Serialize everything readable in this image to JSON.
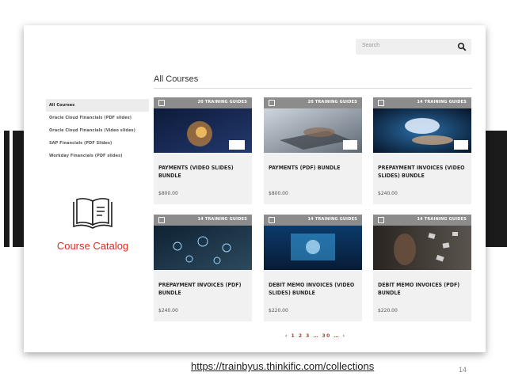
{
  "search": {
    "placeholder": "Search"
  },
  "page_title": "All Courses",
  "sidebar": {
    "items": [
      {
        "label": "All Courses"
      },
      {
        "label": "Oracle Cloud Financials (PDF slides)"
      },
      {
        "label": "Oracle Cloud Financials (Video slides)"
      },
      {
        "label": "SAP Financials (PDF Slides)"
      },
      {
        "label": "Workday Financials (PDF slides)"
      }
    ]
  },
  "catalog": {
    "label": "Course Catalog",
    "icon": "open-book-icon"
  },
  "courses": [
    {
      "count": "20 TRAINING GUIDES",
      "name": "PAYMENTS (VIDEO SLIDES) BUNDLE",
      "price": "$800.00"
    },
    {
      "count": "20 TRAINING GUIDES",
      "name": "PAYMENTS (PDF) BUNDLE",
      "price": "$800.00"
    },
    {
      "count": "14 TRAINING GUIDES",
      "name": "PREPAYMENT INVOICES (VIDEO SLIDES) BUNDLE",
      "price": "$240.00"
    },
    {
      "count": "14 TRAINING GUIDES",
      "name": "PREPAYMENT INVOICES (PDF) BUNDLE",
      "price": "$240.00"
    },
    {
      "count": "14 TRAINING GUIDES",
      "name": "DEBIT MEMO INVOICES (VIDEO SLIDES) BUNDLE",
      "price": "$220.00"
    },
    {
      "count": "14 TRAINING GUIDES",
      "name": "DEBIT MEMO INVOICES (PDF) BUNDLE",
      "price": "$220.00"
    }
  ],
  "pagination": {
    "text": "‹ 1 2 3 … 30 … ›"
  },
  "footer": {
    "url": "https://trainbyus.thinkific.com/collections",
    "page_number": "14"
  },
  "colors": {
    "accent": "#d6301f",
    "side_bars": "#1b1b1b",
    "tile_header": "#8c8c8c"
  }
}
